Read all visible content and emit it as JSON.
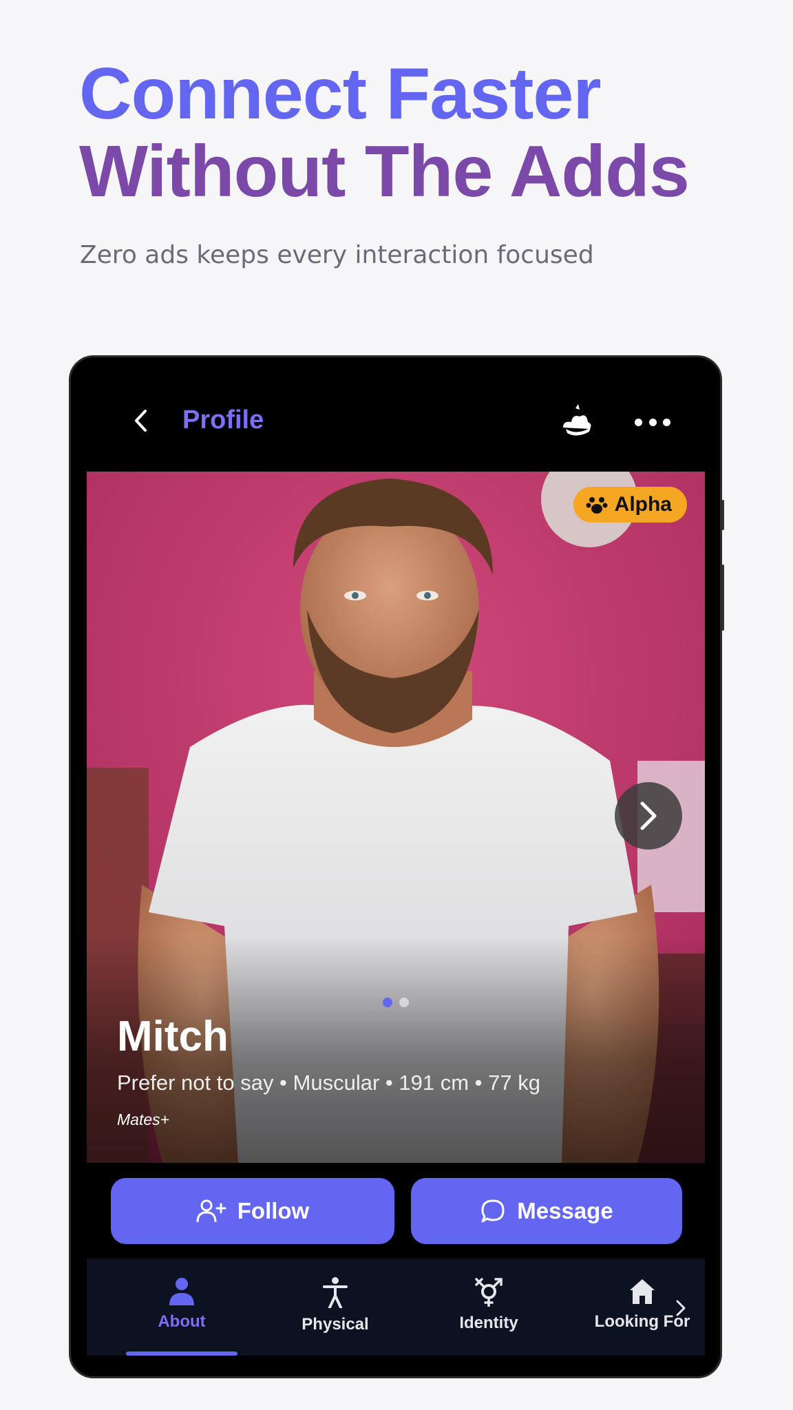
{
  "hero": {
    "title_line1": "Connect Faster",
    "title_line2": "Without The Adds",
    "subtitle": "Zero ads keeps every interaction focused"
  },
  "appbar": {
    "title": "Profile",
    "back_icon": "chevron-left-icon",
    "chef_icon": "chef-hat-icon",
    "more_icon": "more-horizontal-icon"
  },
  "profile": {
    "badge": "Alpha",
    "badge_icon": "paw-icon",
    "name": "Mitch",
    "stats": "Prefer not to say • Muscular • 191 cm • 77 kg",
    "tier": "Mates+",
    "photo_count": 2,
    "active_photo": 1
  },
  "actions": {
    "follow": "Follow",
    "message": "Message"
  },
  "tabs": [
    {
      "label": "About",
      "icon": "person-icon",
      "active": true
    },
    {
      "label": "Physical",
      "icon": "body-icon",
      "active": false
    },
    {
      "label": "Identity",
      "icon": "gender-icon",
      "active": false
    },
    {
      "label": "Looking For",
      "icon": "home-icon",
      "active": false
    }
  ],
  "colors": {
    "accent": "#6366f1",
    "title_purple": "#7b4aa9",
    "badge": "#f5a623",
    "tabbar": "#0c1222"
  }
}
